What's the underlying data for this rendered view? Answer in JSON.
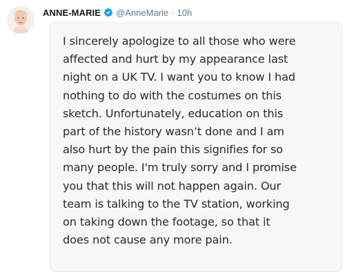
{
  "tweet": {
    "author": {
      "display_name": "ANNE-MARIE",
      "handle": "@AnneMarie",
      "verified_icon": "verified-badge-icon",
      "avatar": "avatar-photo"
    },
    "separator": "·",
    "timestamp": "10h",
    "image_text": "I sincerely apologize to all those who were\naffected and hurt by my appearance last\nnight on a UK TV. I want you to know I had\nnothing to do with the costumes on this\nsketch. Unfortunately, education on this\npart of the history wasn’t done and I am\nalso hurt by the pain this signifies for so\nmany people. I'm truly sorry and I promise\nyou that this will not happen again. Our\nteam is talking to the TV station, working\non taking down the footage, so that it\ndoes not cause any more pain."
  },
  "colors": {
    "verified_blue": "#1da1f2",
    "muted_text": "#657786",
    "card_background": "#f8f8f6"
  }
}
